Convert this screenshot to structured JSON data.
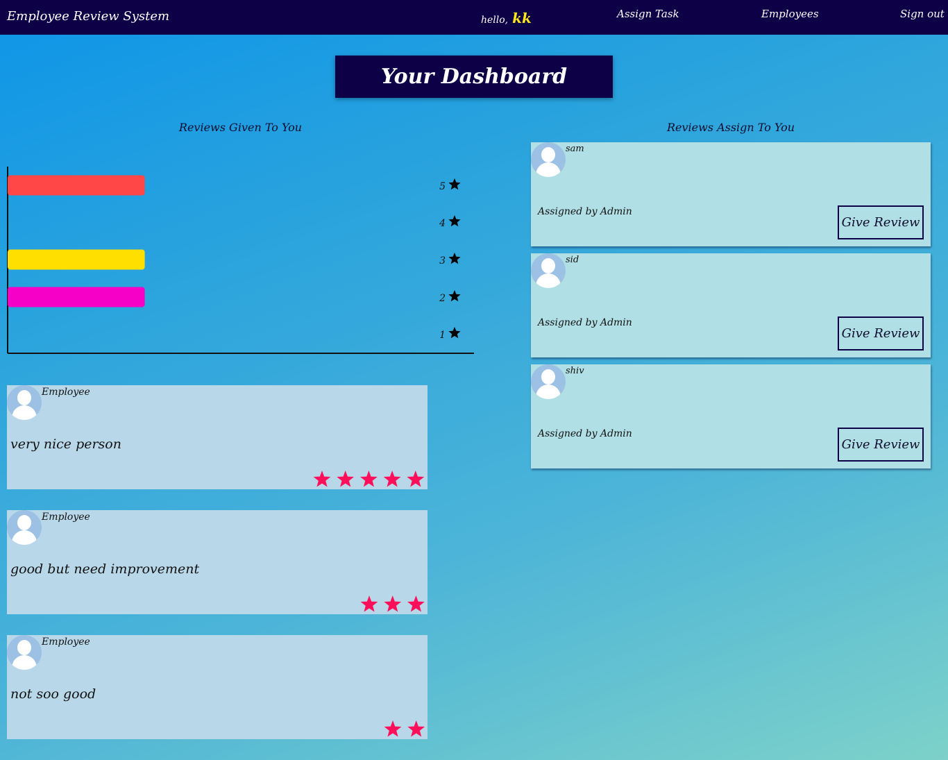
{
  "header": {
    "brand": "Employee Review System",
    "greeting": "hello,",
    "username": "kk",
    "nav": {
      "assign_task": "Assign Task",
      "employees": "Employees",
      "sign_out": "Sign out"
    }
  },
  "dashboard": {
    "title": "Your Dashboard"
  },
  "reviews_given": {
    "title": "Reviews Given To You",
    "items": [
      {
        "author": "Employee",
        "comment": "very nice person",
        "rating": 5
      },
      {
        "author": "Employee",
        "comment": "good but need improvement",
        "rating": 3
      },
      {
        "author": "Employee",
        "comment": "not soo good",
        "rating": 2
      }
    ]
  },
  "reviews_assigned": {
    "title": "Reviews Assign To You",
    "items": [
      {
        "name": "sam",
        "assigned_by": "Assigned by Admin",
        "button": "Give Review"
      },
      {
        "name": "sid",
        "assigned_by": "Assigned by Admin",
        "button": "Give Review"
      },
      {
        "name": "shiv",
        "assigned_by": "Assigned by Admin",
        "button": "Give Review"
      }
    ]
  },
  "chart_data": {
    "type": "bar",
    "orientation": "horizontal",
    "categories": [
      "5",
      "4",
      "3",
      "2",
      "1"
    ],
    "values": [
      1,
      0,
      1,
      1,
      0
    ],
    "colors": [
      "#ff4747",
      "#2aa3dd",
      "#ffdf00",
      "#f600c8",
      "#2aa3dd"
    ],
    "xlim": [
      0,
      3.35
    ],
    "star_color": "#000000"
  },
  "star_color": "#ff0f59"
}
